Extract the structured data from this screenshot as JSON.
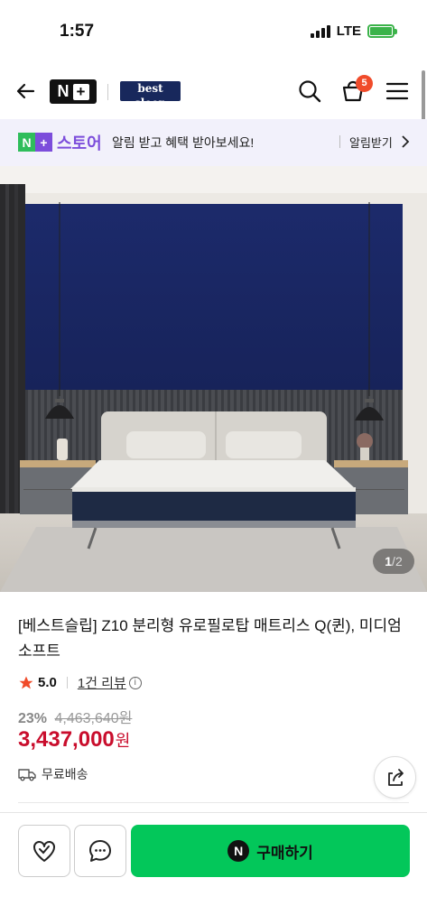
{
  "status_bar": {
    "time": "1:57",
    "network": "LTE",
    "battery_charging": true
  },
  "header": {
    "nplus_logo": "N+",
    "brand_logo": "best sleep",
    "brand_sub": "",
    "cart_count": "5",
    "icons": [
      "back-arrow-icon",
      "search-icon",
      "cart-icon",
      "menu-icon"
    ]
  },
  "banner": {
    "logo_n": "N",
    "logo_plus": "+",
    "store_label": "스토어",
    "message": "알림 받고 혜택 받아보세요!",
    "subscribe_label": "알림받기"
  },
  "gallery": {
    "current": "1",
    "total": "2",
    "separator": "/"
  },
  "product": {
    "title": "[베스트슬립] Z10 분리형 유로필로탑 매트리스 Q(퀸), 미디엄소프트",
    "rating": "5.0",
    "reviews": "1건 리뷰",
    "discount": "23%",
    "original_price": "4,463,640원",
    "price": "3,437,000",
    "currency": "원",
    "shipping": "무료배송"
  },
  "bottom_bar": {
    "buy_logo": "N",
    "buy_label": "구매하기"
  },
  "colors": {
    "buy_green": "#03c75a",
    "price_red": "#c90d2c",
    "store_purple": "#7c4ddb",
    "badge_orange": "#f04b2a"
  }
}
